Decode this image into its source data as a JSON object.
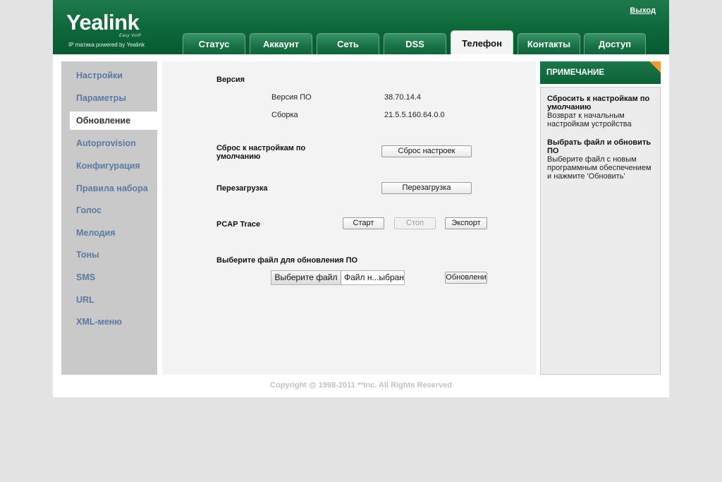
{
  "header": {
    "brand": "Yealink",
    "tagline": "Easy VoIP",
    "powered_by": "IP mатика powered by Yealink",
    "logout_label": "Выход"
  },
  "tabs": [
    {
      "label": "Статус",
      "active": false
    },
    {
      "label": "Аккаунт",
      "active": false
    },
    {
      "label": "Сеть",
      "active": false
    },
    {
      "label": "DSS",
      "active": false
    },
    {
      "label": "Телефон",
      "active": true
    },
    {
      "label": "Контакты",
      "active": false
    },
    {
      "label": "Доступ",
      "active": false
    }
  ],
  "sidebar": {
    "items": [
      {
        "label": "Настройки"
      },
      {
        "label": "Параметры"
      },
      {
        "label": "Обновление",
        "active": true
      },
      {
        "label": "Autoprovision"
      },
      {
        "label": "Конфигурация"
      },
      {
        "label": "Правила набора"
      },
      {
        "label": "Голос"
      },
      {
        "label": "Мелодия"
      },
      {
        "label": "Тоны"
      },
      {
        "label": "SMS"
      },
      {
        "label": "URL"
      },
      {
        "label": "XML-меню"
      }
    ]
  },
  "main": {
    "version": {
      "heading": "Версия",
      "firmware_label": "Версия ПО",
      "firmware_value": "38.70.14.4",
      "build_label": "Сборка",
      "build_value": "21.5.5.160.64.0.0"
    },
    "reset": {
      "heading": "Сброс к настройкам по умолчанию",
      "button_label": "Сброс настроек"
    },
    "reboot": {
      "heading": "Перезагрузка",
      "button_label": "Перезагрузка"
    },
    "pcap": {
      "heading": "PCAP Trace",
      "start_label": "Старт",
      "stop_label": "Стоп",
      "export_label": "Экспорт"
    },
    "upgrade": {
      "heading": "Выберите файл для обновления ПО",
      "choose_file_label": "Выберите файл",
      "no_file_text": "Файл н...ыбран",
      "upgrade_label": "Обновлени"
    }
  },
  "note": {
    "heading": "ПРИМЕЧАНИЕ",
    "entries": [
      {
        "title": "Сбросить к настройкам по умолчанию",
        "text": "Возврат к начальным настройкам устройства"
      },
      {
        "title": "Выбрать файл и обновить ПО",
        "text": "Выберите файл с новым программным обеспечением и нажмите 'Обновить'"
      }
    ]
  },
  "footer": {
    "copyright": "Copyright @ 1998-2011 **Inc. All Rights Reserved"
  },
  "colors": {
    "brand_green": "#0f6a3c",
    "nav_link": "#5a7aa3",
    "note_accent": "#f39a2c"
  }
}
